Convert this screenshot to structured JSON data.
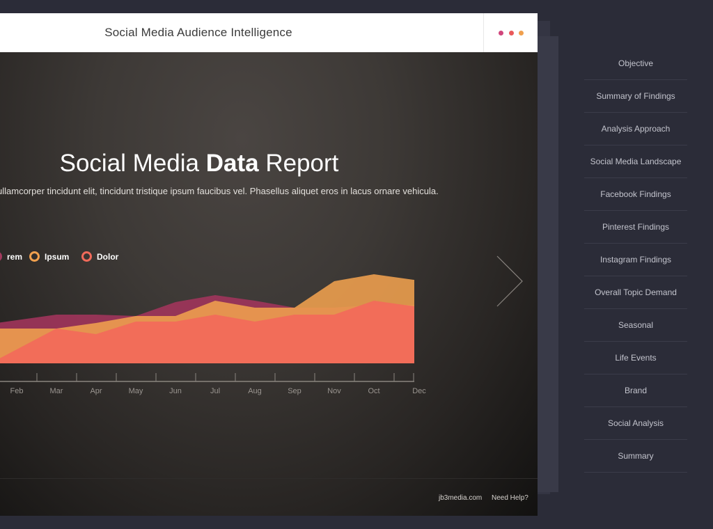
{
  "header": {
    "title": "Social Media Audience Intelligence",
    "menu_dots": [
      "#d0467c",
      "#e9595b",
      "#f0a04e"
    ]
  },
  "slide": {
    "title_pre": "Social Media ",
    "title_bold": "Data",
    "title_post": " Report",
    "subtitle": "ullamcorper tincidunt elit, tincidunt tristique ipsum faucibus vel. Phasellus aliquet eros in lacus ornare vehicula.",
    "next_icon": "chevron-right-icon"
  },
  "chart_data": {
    "type": "area",
    "categories": [
      "Feb",
      "Mar",
      "Apr",
      "May",
      "Jun",
      "Jul",
      "Aug",
      "Sep",
      "Nov",
      "Oct",
      "Dec"
    ],
    "legend": [
      {
        "label": "rem",
        "color": "#a33a5e"
      },
      {
        "label": "Ipsum",
        "color": "#f0a04e"
      },
      {
        "label": "Dolor",
        "color": "#f06a5a"
      }
    ],
    "series": [
      {
        "name": "rem",
        "color": "#a3345c",
        "values": [
          62,
          70,
          70,
          68,
          88,
          98,
          90,
          80,
          80,
          84,
          84
        ]
      },
      {
        "name": "Ipsum",
        "color": "#f0a04e",
        "values": [
          50,
          50,
          58,
          68,
          68,
          90,
          80,
          80,
          118,
          128,
          120
        ]
      },
      {
        "name": "Dolor",
        "color": "#f26a5a",
        "values": [
          20,
          50,
          42,
          60,
          60,
          70,
          60,
          70,
          70,
          90,
          82
        ]
      }
    ],
    "ylim": [
      0,
      130
    ]
  },
  "footer": {
    "site": "jb3media.com",
    "help": "Need Help?"
  },
  "sidebar": {
    "items": [
      {
        "label": "Objective"
      },
      {
        "label": "Summary of Findings"
      },
      {
        "label": "Analysis Approach"
      },
      {
        "label": "Social Media Landscape"
      },
      {
        "label": "Facebook Findings"
      },
      {
        "label": "Pinterest Findings"
      },
      {
        "label": "Instagram Findings"
      },
      {
        "label": "Overall Topic Demand"
      },
      {
        "label": "Seasonal"
      },
      {
        "label": "Life Events"
      },
      {
        "label": "Brand"
      },
      {
        "label": "Social Analysis"
      },
      {
        "label": "Summary"
      }
    ]
  }
}
